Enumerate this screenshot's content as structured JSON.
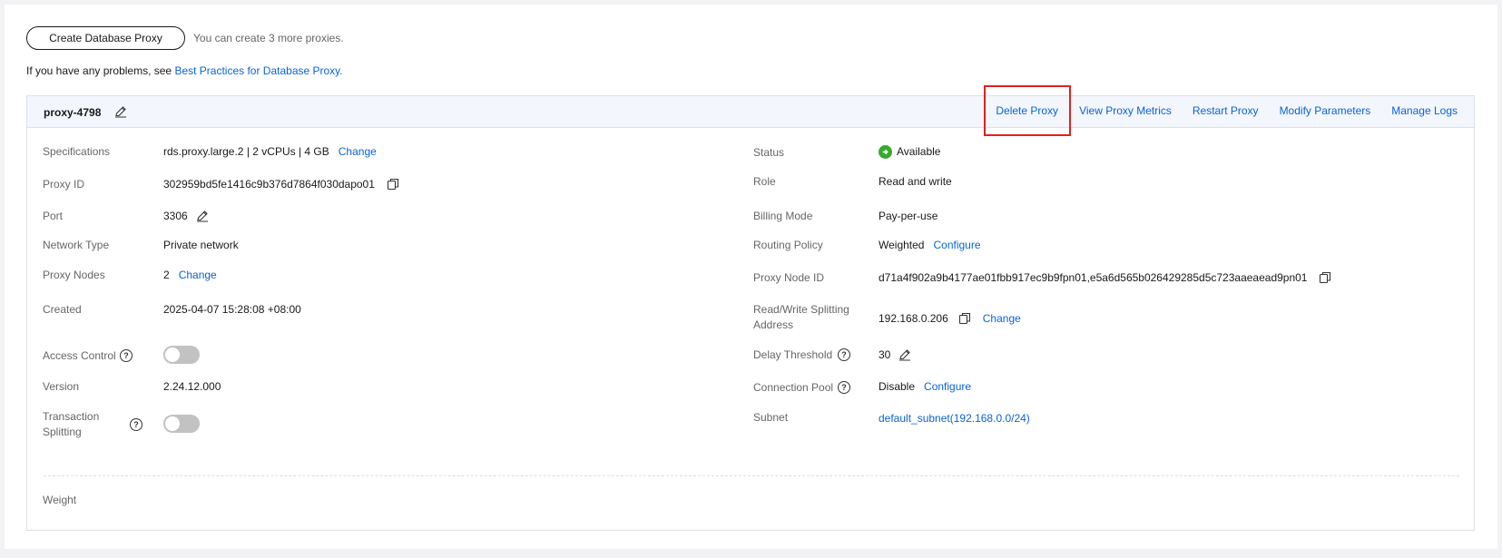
{
  "top": {
    "create_button": "Create Database Proxy",
    "quota_text": "You can create 3 more proxies.",
    "tip_prefix": "If you have any problems, see",
    "tip_link": "Best Practices for Database Proxy."
  },
  "card": {
    "proxy_name": "proxy-4798",
    "actions": [
      "Delete Proxy",
      "View Proxy Metrics",
      "Restart Proxy",
      "Modify Parameters",
      "Manage Logs"
    ]
  },
  "left_fields": {
    "specifications": {
      "label": "Specifications",
      "value": "rds.proxy.large.2 | 2 vCPUs | 4 GB",
      "link": "Change"
    },
    "proxy_id": {
      "label": "Proxy ID",
      "value": "302959bd5fe1416c9b376d7864f030dapo01"
    },
    "port": {
      "label": "Port",
      "value": "3306"
    },
    "network_type": {
      "label": "Network Type",
      "value": "Private network"
    },
    "proxy_nodes": {
      "label": "Proxy Nodes",
      "value": "2",
      "link": "Change"
    },
    "created": {
      "label": "Created",
      "value": "2025-04-07 15:28:08 +08:00"
    },
    "access_control": {
      "label": "Access Control",
      "enabled": false
    },
    "version": {
      "label": "Version",
      "value": "2.24.12.000"
    },
    "transaction_splitting": {
      "label_line1": "Transaction",
      "label_line2": "Splitting",
      "enabled": false
    },
    "weight": {
      "label": "Weight"
    }
  },
  "right_fields": {
    "status": {
      "label": "Status",
      "value": "Available"
    },
    "role": {
      "label": "Role",
      "value": "Read and write"
    },
    "billing_mode": {
      "label": "Billing Mode",
      "value": "Pay-per-use"
    },
    "routing_policy": {
      "label": "Routing Policy",
      "value": "Weighted",
      "link": "Configure"
    },
    "proxy_node_id": {
      "label": "Proxy Node ID",
      "value": "d71a4f902a9b4177ae01fbb917ec9b9fpn01,e5a6d565b026429285d5c723aaeaead9pn01"
    },
    "rw_address": {
      "label_line1": "Read/Write Splitting",
      "label_line2": "Address",
      "value": "192.168.0.206",
      "link": "Change"
    },
    "delay_threshold": {
      "label": "Delay Threshold",
      "value": "30"
    },
    "connection_pool": {
      "label": "Connection Pool",
      "value": "Disable",
      "link": "Configure"
    },
    "subnet": {
      "label": "Subnet",
      "value": "default_subnet(192.168.0.0/24)"
    }
  },
  "colors": {
    "accent": "#0a63d6",
    "status_green": "#37a92e",
    "highlight": "#e02020"
  }
}
